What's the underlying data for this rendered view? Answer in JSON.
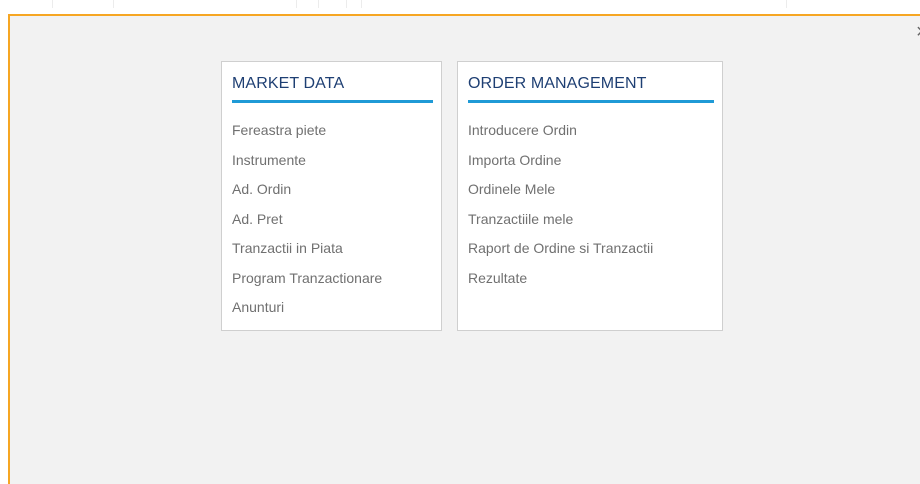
{
  "close_glyph": "×",
  "market_data": {
    "title": "MARKET DATA",
    "items": [
      "Fereastra piete",
      "Instrumente",
      "Ad. Ordin",
      "Ad. Pret",
      "Tranzactii in Piata",
      "Program Tranzactionare",
      "Anunturi"
    ]
  },
  "order_management": {
    "title": "ORDER MANAGEMENT",
    "items": [
      "Introducere Ordin",
      "Importa Ordine",
      "Ordinele Mele",
      "Tranzactiile mele",
      "Raport de Ordine si Tranzactii",
      "Rezultate"
    ]
  },
  "colors": {
    "accent_border": "#f6a623",
    "header_text": "#1e3f73",
    "header_underline": "#1f9ad6",
    "link_text": "#707070",
    "panel_bg": "#f2f2f2"
  }
}
